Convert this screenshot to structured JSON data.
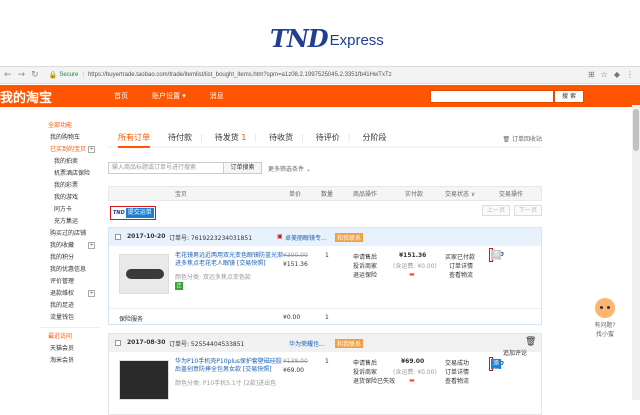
{
  "brand": {
    "logo_main": "TND",
    "logo_sub": "Express"
  },
  "browser": {
    "secure_label": "Secure",
    "url": "https://buyertrade.taobao.com/trade/itemlist/list_bought_items.htm?spm=a1z08.2.1997525045.2.3351fb41HwTxTz"
  },
  "topnav": {
    "brand": "我的淘宝",
    "items": [
      "首页",
      "账户设置 ▾",
      "消息"
    ],
    "search_button": "搜 索"
  },
  "sidebar": {
    "header": "全部功能",
    "items": [
      {
        "label": "我的购物车",
        "type": "item"
      },
      {
        "label": "已买到的宝贝",
        "type": "item",
        "active": true,
        "plus": true
      },
      {
        "label": "我的拍卖",
        "type": "sub"
      },
      {
        "label": "机票酒店保险",
        "type": "sub"
      },
      {
        "label": "我的彩票",
        "type": "sub"
      },
      {
        "label": "我的游戏",
        "type": "sub"
      },
      {
        "label": "同方卡",
        "type": "sub"
      },
      {
        "label": "充方集运",
        "type": "sub"
      },
      {
        "label": "购买过的店铺",
        "type": "item"
      },
      {
        "label": "我的收藏",
        "type": "item",
        "plus": true
      },
      {
        "label": "我的积分",
        "type": "item"
      },
      {
        "label": "我的优惠信息",
        "type": "item"
      },
      {
        "label": "评价管理",
        "type": "item"
      },
      {
        "label": "退款维权",
        "type": "item",
        "plus": true
      },
      {
        "label": "我的足迹",
        "type": "item"
      },
      {
        "label": "流量钱包",
        "type": "item"
      }
    ],
    "recent_header": "最近访问",
    "recent_items": [
      "天猫会员",
      "淘米会员"
    ]
  },
  "main": {
    "tabs": [
      {
        "label": "所有订单",
        "active": true
      },
      {
        "label": "待付款"
      },
      {
        "label": "待发货",
        "count": "1"
      },
      {
        "label": "待收货"
      },
      {
        "label": "待评价"
      },
      {
        "label": "分阶段"
      }
    ],
    "recycle_label": "订单回收站",
    "search_placeholder": "输入商品标题或订单号进行搜索",
    "search_button": "订单搜索",
    "more_filters": "更多筛选条件 ⌄",
    "columns": [
      "宝贝",
      "单价",
      "数量",
      "商品操作",
      "实付款",
      "交易状态 ∨",
      "交易操作"
    ],
    "tnd_submit_label": "提交运单",
    "pager": [
      "上一页",
      "下一页"
    ]
  },
  "orders": [
    {
      "date": "2017-10-20",
      "order_no_label": "订单号: 7619223234031851",
      "shop": "卓美丽眼镜专...",
      "chat": "和我联系",
      "title": "老花镜男远近两用双光变色眼镜防蓝光渐进多焦点老花老人眼镜 [交易快照]",
      "option": "颜色分类: 双远多焦点变色款",
      "price_old": "¥300.00",
      "price_new": "¥151.36",
      "qty": "1",
      "ops": [
        "申请售后",
        "投诉商家",
        "退运保险"
      ],
      "paid": "¥151.36",
      "paid_note": "(含运费: ¥0.00)",
      "status": [
        "买家已付款",
        "订单详情",
        "查看物流"
      ],
      "tnd_button": "添加包裹",
      "extra_label": "保险服务",
      "extra_price": "¥0.00",
      "extra_qty": "1"
    },
    {
      "date": "2017-08-30",
      "order_no_label": "订单号: 52554404533851",
      "shop": "华为荣耀也...",
      "chat": "和我联系",
      "title": "华为P10手机壳P10plus保护套壁磁硅胶后盖创意防摔全包男女款 [交易快照]",
      "option": "颜色分类: P10手机5.1寸 [2款]进出色",
      "price_old": "¥138.00",
      "price_new": "¥69.00",
      "qty": "1",
      "ops": [
        "申请售后",
        "投诉商家",
        "退货保险已失效"
      ],
      "paid": "¥69.00",
      "paid_note": "(含运费: ¥0.00)",
      "status": [
        "交易成功",
        "订单详情",
        "查看物流"
      ],
      "tnd_button": "添加包裹",
      "extra_status": "追加评论"
    }
  ],
  "right_widget": {
    "line1": "有问题?",
    "line2": "找小蜜"
  }
}
